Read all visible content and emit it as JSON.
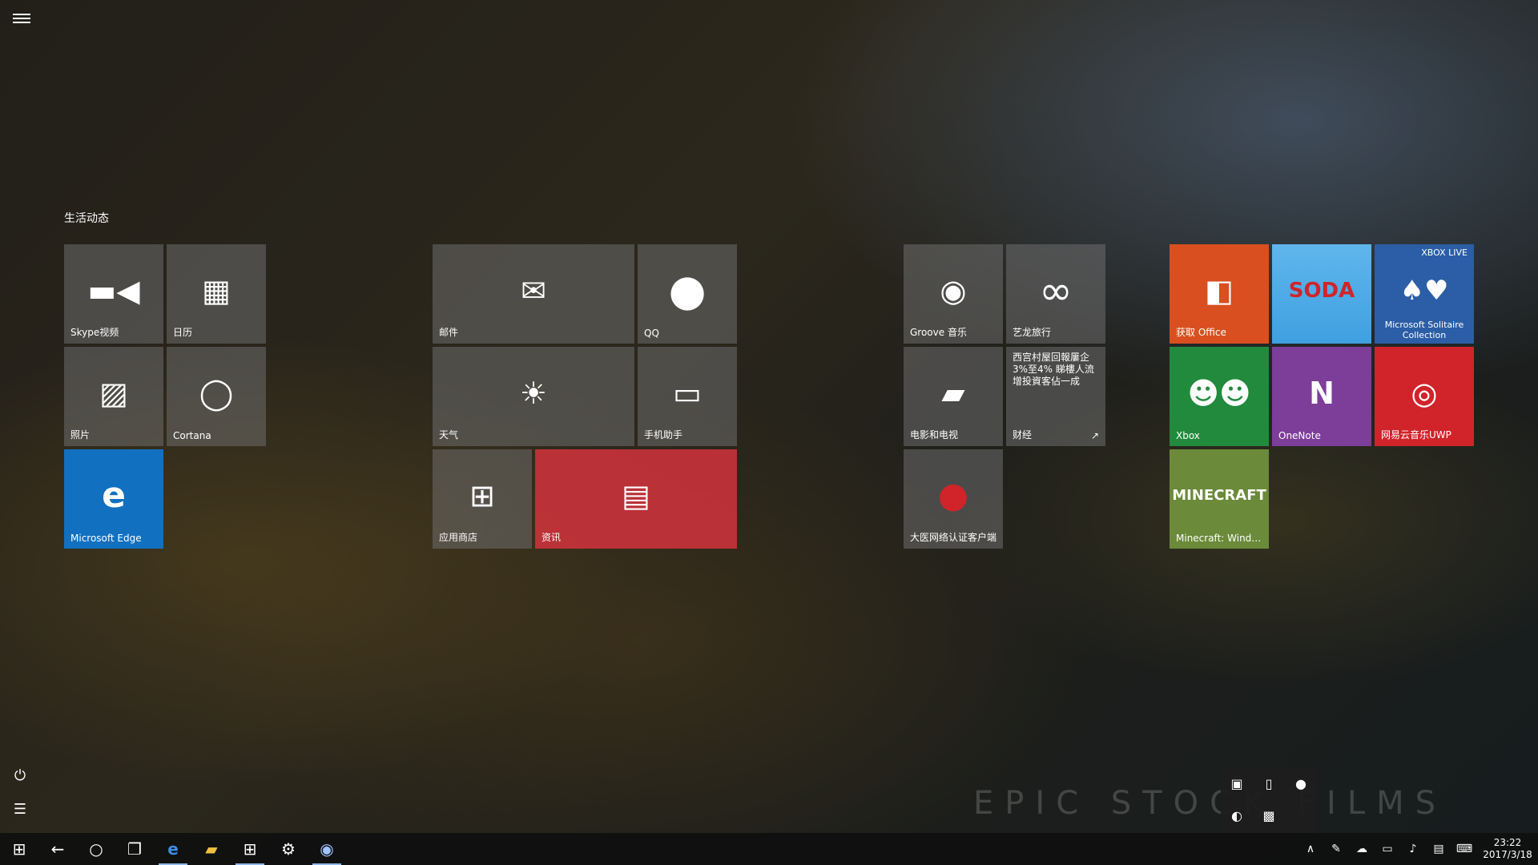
{
  "start": {
    "group_title": "生活动态",
    "tiles": {
      "skype": "Skype视频",
      "calendar": "日历",
      "photos": "照片",
      "cortana": "Cortana",
      "edge": "Microsoft Edge",
      "mail": "邮件",
      "qq": "QQ",
      "weather": "天气",
      "phone": "手机助手",
      "store": "应用商店",
      "news": "资讯",
      "groove": "Groove 音乐",
      "elong": "艺龙旅行",
      "movies": "电影和电视",
      "finance": "财经",
      "finance_headline": "西宫村屋回報屢企3%至4% 睇樓人流增投資客佔一成",
      "client": "大医网络认证客户端",
      "office": "获取 Office",
      "candy": "",
      "solitaire": "Microsoft Solitaire Collection",
      "xbox_live": "XBOX LIVE",
      "xbox": "Xbox",
      "onenote": "OneNote",
      "netease": "网易云音乐UWP",
      "minecraft": "Minecraft: Windo..."
    }
  },
  "watermark": "EPIC STOCK FILMS",
  "taskbar": {
    "time": "23:22",
    "date": "2017/3/18"
  },
  "icons": {
    "menu": "hamburger-icon",
    "power": "power-icon",
    "all_apps": "list-icon",
    "start": "windows-icon",
    "back": "back-arrow-icon",
    "cortana": "cortana-ring-icon",
    "task_view": "task-view-icon",
    "edge": "edge-icon",
    "explorer": "folder-icon",
    "store": "store-icon",
    "settings": "gear-icon",
    "steam": "steam-icon"
  },
  "colors": {
    "edge_tile": "#1170c0",
    "news_tile": "#d2323c",
    "office_tile": "#d94f1f",
    "onenote_tile": "#7d3e9a",
    "netease_tile": "#d0242a",
    "xbox_tile": "#218a3c",
    "solitaire_tile": "#2b5ea6",
    "minecraft_tile": "#6b8a3a",
    "candy_tile": "#3fa0e0"
  }
}
